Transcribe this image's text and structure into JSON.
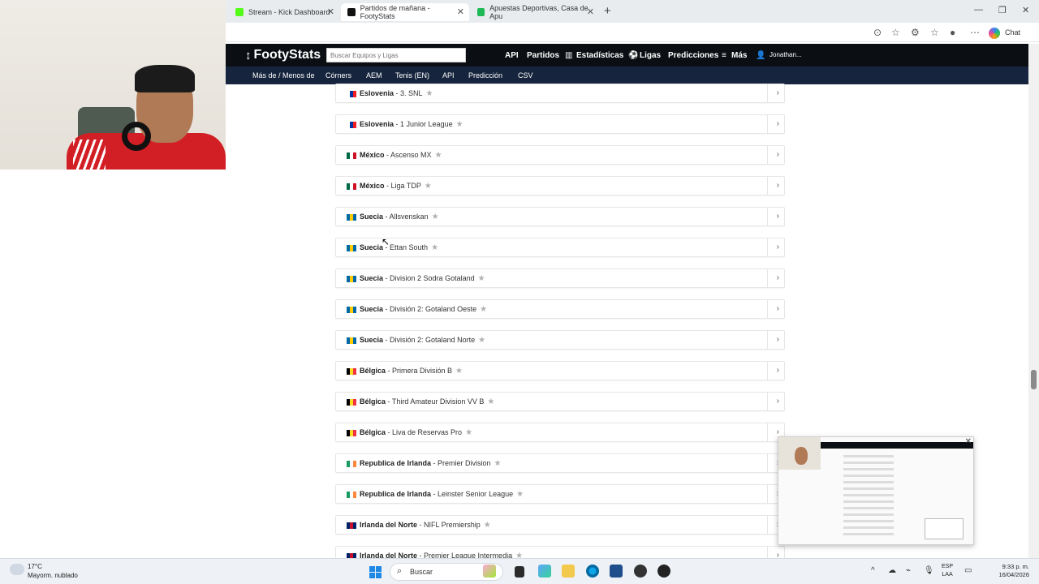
{
  "browser": {
    "tabs": [
      {
        "label": "Stream - Kick Dashboard",
        "favicon": "kick-favicon",
        "color": "#53fc18"
      },
      {
        "label": "Partidos de mañana - FootyStats",
        "favicon": "footystats-favicon",
        "color": "#111111"
      },
      {
        "label": "Apuestas Deportivas, Casa de Apu",
        "favicon": "betting-favicon",
        "color": "#1db954"
      }
    ],
    "chat_label": "Chat"
  },
  "site": {
    "logo": "FootyStats",
    "search_placeholder": "Buscar Equipos y Ligas",
    "nav": [
      "API",
      "Partidos",
      "Estadísticas",
      "Ligas",
      "Predicciones",
      "Más"
    ],
    "user": "Jonathan...",
    "subnav": [
      "Más de / Menos de",
      "Córners",
      "AEM",
      "Tenis (EN)",
      "API",
      "Predicción",
      "CSV"
    ]
  },
  "leagues": [
    {
      "country": "Eslovenia",
      "league": "3. SNL",
      "flag": [
        "#ffffff",
        "#0033a0",
        "#ed1c24"
      ]
    },
    {
      "country": "Eslovenia",
      "league": "1 Junior League",
      "flag": [
        "#ffffff",
        "#0033a0",
        "#ed1c24"
      ]
    },
    {
      "country": "México",
      "league": "Ascenso MX",
      "flag": [
        "#006847",
        "#ffffff",
        "#ce1126"
      ]
    },
    {
      "country": "México",
      "league": "Liga TDP",
      "flag": [
        "#006847",
        "#ffffff",
        "#ce1126"
      ]
    },
    {
      "country": "Suecia",
      "league": "Allsvenskan",
      "flag": [
        "#006aa7",
        "#fecc00",
        "#006aa7"
      ]
    },
    {
      "country": "Suecia",
      "league": "Ettan South",
      "flag": [
        "#006aa7",
        "#fecc00",
        "#006aa7"
      ]
    },
    {
      "country": "Suecia",
      "league": "Division 2 Sodra Gotaland",
      "flag": [
        "#006aa7",
        "#fecc00",
        "#006aa7"
      ]
    },
    {
      "country": "Suecia",
      "league": "División 2: Gotaland Oeste",
      "flag": [
        "#006aa7",
        "#fecc00",
        "#006aa7"
      ]
    },
    {
      "country": "Suecia",
      "league": "División 2: Gotaland Norte",
      "flag": [
        "#006aa7",
        "#fecc00",
        "#006aa7"
      ]
    },
    {
      "country": "Bélgica",
      "league": "Primera División B",
      "flag": [
        "#000000",
        "#fdda24",
        "#ef3340"
      ]
    },
    {
      "country": "Bélgica",
      "league": "Third Amateur Division VV B",
      "flag": [
        "#000000",
        "#fdda24",
        "#ef3340"
      ]
    },
    {
      "country": "Bélgica",
      "league": "Liva de Reservas Pro",
      "flag": [
        "#000000",
        "#fdda24",
        "#ef3340"
      ]
    },
    {
      "country": "Republica de Irlanda",
      "league": "Premier Division",
      "flag": [
        "#169b62",
        "#ffffff",
        "#ff883e"
      ]
    },
    {
      "country": "Republica de Irlanda",
      "league": "Leinster Senior League",
      "flag": [
        "#169b62",
        "#ffffff",
        "#ff883e"
      ]
    },
    {
      "country": "Irlanda del Norte",
      "league": "NIFL Premiership",
      "flag": [
        "#012169",
        "#c8102e",
        "#012169"
      ]
    },
    {
      "country": "Irlanda del Norte",
      "league": "Premier League Intermedia",
      "flag": [
        "#012169",
        "#c8102e",
        "#012169"
      ]
    }
  ],
  "taskbar": {
    "temperature": "17°C",
    "weather": "Mayorm. nublado",
    "search_label": "Buscar",
    "lang_top": "ESP",
    "lang_bottom": "LAA",
    "time": "9:33 p. m.",
    "date": "16/04/2026"
  }
}
